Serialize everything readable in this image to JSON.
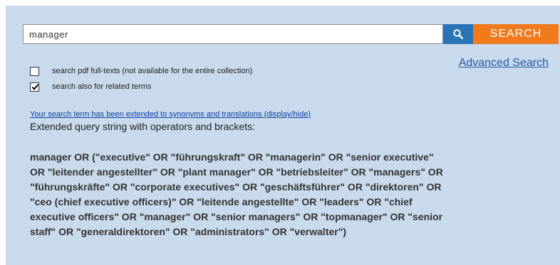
{
  "search": {
    "value": "manager",
    "button_label": "SEARCH",
    "advanced_link": "Advanced Search"
  },
  "options": [
    {
      "label": "search pdf full-texts (not available for the entire collection)",
      "checked": false
    },
    {
      "label": "search also for related terms",
      "checked": true
    }
  ],
  "extended": {
    "link_text": "Your search term has been extended to synonyms and translations (display/hide)",
    "intro": "Extended query string with operators and brackets:",
    "query": "manager OR (\"executive\" OR \"führungskraft\" OR \"managerin\" OR \"senior executive\" OR \"leitender angestellter\" OR \"plant manager\" OR \"betriebsleiter\" OR \"managers\" OR \"führungskräfte\" OR \"corporate executives\" OR \"geschäftsführer\" OR \"direktoren\" OR \"ceo (chief executive officers)\" OR \"leitende angestellte\" OR \"leaders\" OR \"chief executive officers\" OR \"manager\" OR \"senior managers\" OR \"topmanager\" OR \"senior staff\" OR \"generaldirektoren\" OR \"administrators\" OR \"verwalter\")"
  },
  "colors": {
    "panel_background": "#c8daec",
    "search_button": "#f07a1c",
    "magnifier_button": "#2874b6",
    "link": "#2d58a3"
  },
  "icons": {
    "magnifier": "search-icon",
    "check": "checkmark-icon"
  }
}
